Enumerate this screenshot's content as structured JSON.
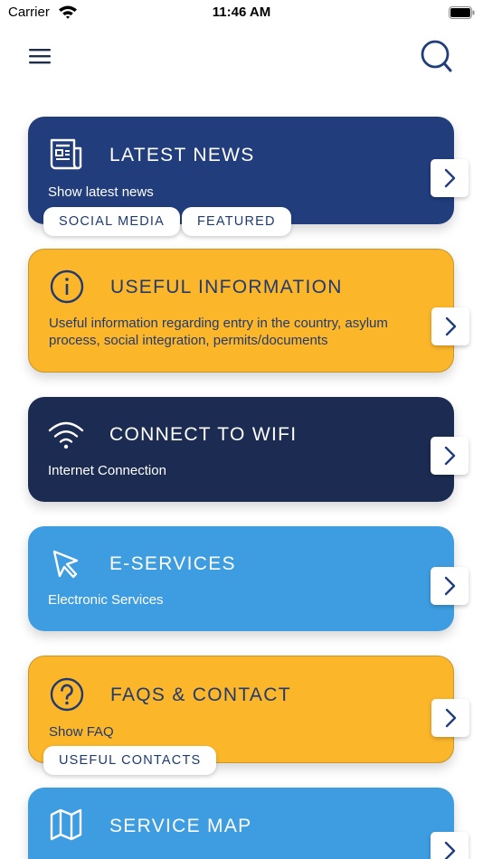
{
  "status_bar": {
    "carrier": "Carrier",
    "time": "11:46 AM"
  },
  "nav": {
    "menu_icon": "hamburger-icon",
    "search_icon": "search-icon"
  },
  "colors": {
    "navy": "#213d7c",
    "yellow": "#fbb62a",
    "dark_navy": "#1b2b52",
    "sky_blue": "#3d9de0",
    "icon_blue": "#1c3a74"
  },
  "cards": [
    {
      "id": "latest-news",
      "icon": "newspaper-icon",
      "title": "LATEST NEWS",
      "subtitle": "Show latest news",
      "tags": [
        "SOCIAL MEDIA",
        "FEATURED"
      ]
    },
    {
      "id": "useful-information",
      "icon": "info-icon",
      "title": "USEFUL INFORMATION",
      "subtitle": "Useful information regarding entry in the country, asylum process, social integration, permits/documents"
    },
    {
      "id": "connect-wifi",
      "icon": "wifi-icon",
      "title": "CONNECT TO WIFI",
      "subtitle": "Internet Connection"
    },
    {
      "id": "e-services",
      "icon": "cursor-icon",
      "title": "E-SERVICES",
      "subtitle": "Electronic Services"
    },
    {
      "id": "faqs-contact",
      "icon": "question-icon",
      "title": "FAQS & CONTACT",
      "subtitle": "Show FAQ",
      "tags": [
        "USEFUL CONTACTS"
      ]
    },
    {
      "id": "service-map",
      "icon": "map-icon",
      "title": "SERVICE MAP"
    }
  ]
}
